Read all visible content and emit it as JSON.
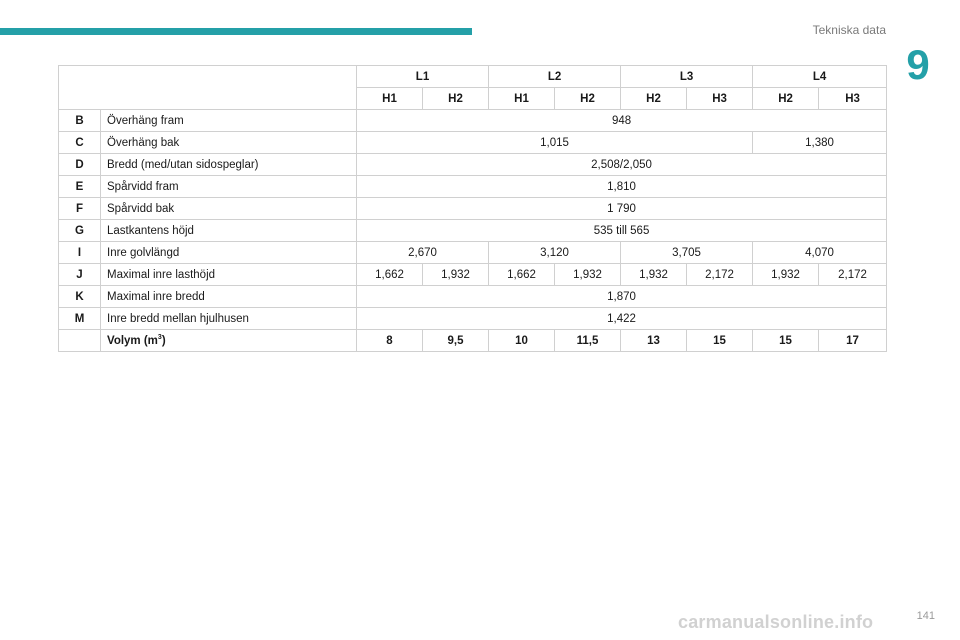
{
  "header": {
    "section_title": "Tekniska data",
    "chapter_number": "9"
  },
  "footer": {
    "page_number": "141",
    "watermark": "carmanualsonline.info"
  },
  "table": {
    "lengths": [
      "L1",
      "L2",
      "L3",
      "L4"
    ],
    "heights": [
      "H1",
      "H2",
      "H1",
      "H2",
      "H2",
      "H3",
      "H2",
      "H3"
    ],
    "rows": {
      "B": {
        "code": "B",
        "label": "Överhäng fram",
        "values": [
          "948"
        ]
      },
      "C": {
        "code": "C",
        "label": "Överhäng bak",
        "values": [
          "1,015",
          "1,380"
        ]
      },
      "D": {
        "code": "D",
        "label": "Bredd (med/utan sidospeglar)",
        "values": [
          "2,508/2,050"
        ]
      },
      "E": {
        "code": "E",
        "label": "Spårvidd fram",
        "values": [
          "1,810"
        ]
      },
      "F": {
        "code": "F",
        "label": "Spårvidd bak",
        "values": [
          "1 790"
        ]
      },
      "G": {
        "code": "G",
        "label": "Lastkantens höjd",
        "values": [
          "535 till 565"
        ]
      },
      "I": {
        "code": "I",
        "label": "Inre golvlängd",
        "values": [
          "2,670",
          "3,120",
          "3,705",
          "4,070"
        ]
      },
      "J": {
        "code": "J",
        "label": "Maximal inre lasthöjd",
        "values": [
          "1,662",
          "1,932",
          "1,662",
          "1,932",
          "1,932",
          "2,172",
          "1,932",
          "2,172"
        ]
      },
      "K": {
        "code": "K",
        "label": "Maximal inre bredd",
        "values": [
          "1,870"
        ]
      },
      "M": {
        "code": "M",
        "label": "Inre bredd mellan hjulhusen",
        "values": [
          "1,422"
        ]
      }
    },
    "volume": {
      "label": "Volym (m",
      "unit_sup": "3",
      "label_close": ")",
      "values": [
        "8",
        "9,5",
        "10",
        "11,5",
        "13",
        "15",
        "15",
        "17"
      ]
    }
  }
}
